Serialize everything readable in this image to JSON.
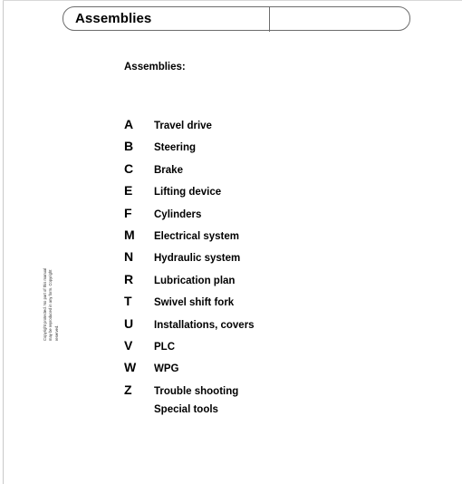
{
  "header": {
    "title": "Assemblies",
    "right_cell_text": ""
  },
  "section": {
    "heading": "Assemblies:"
  },
  "list": {
    "rows": [
      {
        "code": "A",
        "label": "Travel drive"
      },
      {
        "code": "B",
        "label": "Steering"
      },
      {
        "code": "C",
        "label": "Brake"
      },
      {
        "code": "E",
        "label": "Lifting device"
      },
      {
        "code": "F",
        "label": "Cylinders"
      },
      {
        "code": "M",
        "label": "Electrical system"
      },
      {
        "code": "N",
        "label": "Hydraulic system"
      },
      {
        "code": "R",
        "label": "Lubrication plan"
      },
      {
        "code": "T",
        "label": "Swivel shift fork"
      },
      {
        "code": "U",
        "label": "Installations, covers"
      },
      {
        "code": "V",
        "label": "PLC"
      },
      {
        "code": "W",
        "label": "WPG"
      },
      {
        "code": "Z",
        "label": "Trouble shooting"
      },
      {
        "code": "",
        "label": "Special tools"
      }
    ]
  },
  "copyright": {
    "line1": "Copyright protected. No part of this manual",
    "line2": "may be reproduced in any form. Copyright",
    "line3": "reserved."
  },
  "colors": {
    "text": "#000000",
    "border": "#6d6d6d",
    "page_edge": "#c9c9c9",
    "background": "#ffffff"
  }
}
